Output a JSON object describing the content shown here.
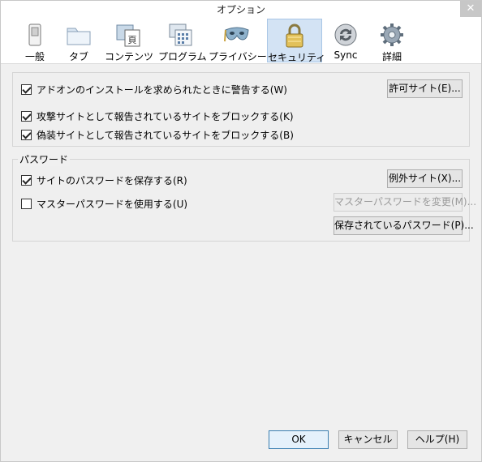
{
  "window": {
    "title": "オプション",
    "close": "✕"
  },
  "tabs": [
    {
      "id": "general",
      "label": "一般",
      "icon": "switch-icon"
    },
    {
      "id": "tabs",
      "label": "タブ",
      "icon": "folder-tabs-icon"
    },
    {
      "id": "content",
      "label": "コンテンツ",
      "icon": "content-page-icon"
    },
    {
      "id": "applications",
      "label": "プログラム",
      "icon": "applications-icon"
    },
    {
      "id": "privacy",
      "label": "プライバシー",
      "icon": "mask-icon"
    },
    {
      "id": "security",
      "label": "セキュリティ",
      "icon": "padlock-icon",
      "active": true
    },
    {
      "id": "sync",
      "label": "Sync",
      "icon": "sync-icon"
    },
    {
      "id": "advanced",
      "label": "詳細",
      "icon": "gear-icon"
    }
  ],
  "security": {
    "warn_addons": {
      "label": "アドオンのインストールを求められたときに警告する(W)",
      "checked": true
    },
    "exceptions_button": "許可サイト(E)...",
    "block_attack": {
      "label": "攻撃サイトとして報告されているサイトをブロックする(K)",
      "checked": true
    },
    "block_forgery": {
      "label": "偽装サイトとして報告されているサイトをブロックする(B)",
      "checked": true
    }
  },
  "passwords": {
    "legend": "パスワード",
    "remember": {
      "label": "サイトのパスワードを保存する(R)",
      "checked": true
    },
    "exceptions_button": "例外サイト(X)...",
    "master": {
      "label": "マスターパスワードを使用する(U)",
      "checked": false
    },
    "change_master_button": "マスターパスワードを変更(M)...",
    "saved_button": "保存されているパスワード(P)..."
  },
  "footer": {
    "ok": "OK",
    "cancel": "キャンセル",
    "help": "ヘルプ(H)"
  },
  "colors": {
    "active_tab_bg": "#d3e3f4",
    "accent": "#3c7fb1"
  }
}
